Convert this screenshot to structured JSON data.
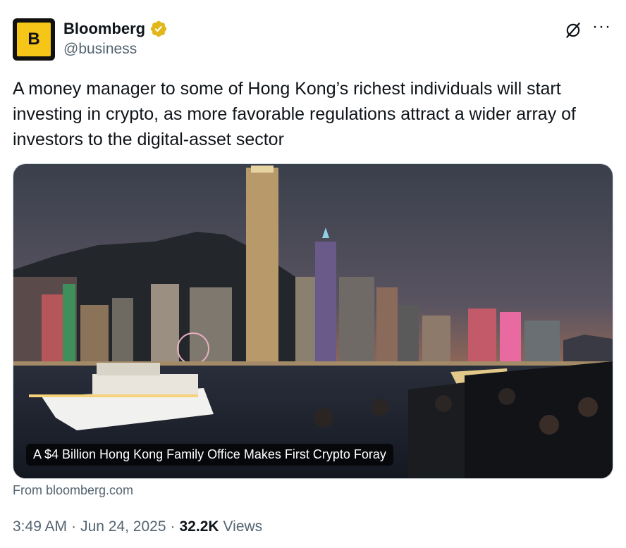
{
  "account": {
    "avatar_letter": "B",
    "display_name": "Bloomberg",
    "handle": "@business",
    "verified_color": "#e2b719"
  },
  "tweet": {
    "text": "A money manager to some of Hong Kong’s richest individuals will start investing in crypto, as more favorable regulations attract a wider array of investors to the digital-asset sector"
  },
  "card": {
    "headline": "A $4 Billion Hong Kong Family Office Makes First Crypto Foray",
    "source": "From bloomberg.com"
  },
  "meta": {
    "time": "3:49 AM",
    "date": "Jun 24, 2025",
    "views_count": "32.2K",
    "views_label": "Views",
    "separator": "·"
  },
  "icons": {
    "grok": "grok-icon",
    "more": "more-icon",
    "verified": "verified-badge-icon"
  }
}
